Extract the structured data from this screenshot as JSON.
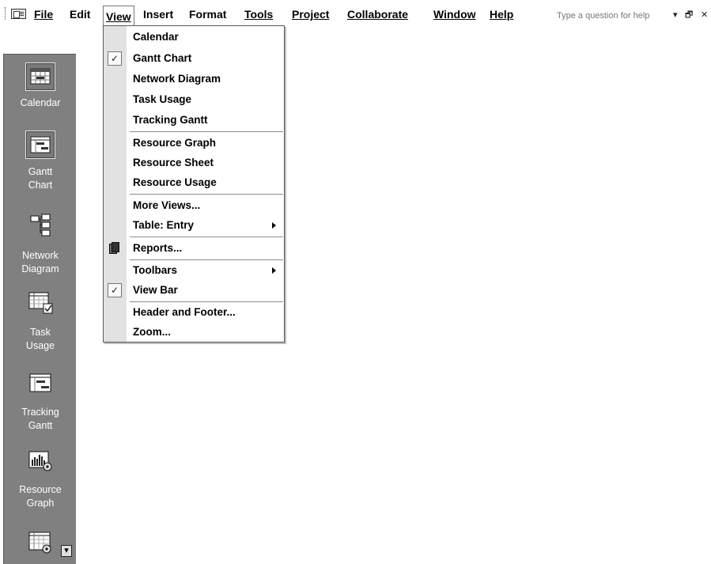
{
  "menubar": {
    "items": [
      {
        "label": "File",
        "active": false
      },
      {
        "label": "Edit",
        "active": false
      },
      {
        "label": "View",
        "active": true
      },
      {
        "label": "Insert",
        "active": false
      },
      {
        "label": "Format",
        "active": false
      },
      {
        "label": "Tools",
        "active": false
      },
      {
        "label": "Project",
        "active": false
      },
      {
        "label": "Collaborate",
        "active": false
      },
      {
        "label": "Window",
        "active": false
      },
      {
        "label": "Help",
        "active": false
      }
    ],
    "help_placeholder": "Type a question for help",
    "controls": {
      "dropdown": "▾",
      "restore": "🗗",
      "close": "✕"
    }
  },
  "view_menu": {
    "items": [
      {
        "label": "Calendar",
        "checked": false
      },
      {
        "label": "Gantt Chart",
        "checked": true
      },
      {
        "label": "Network Diagram",
        "checked": false
      },
      {
        "label": "Task Usage",
        "checked": false
      },
      {
        "label": "Tracking Gantt",
        "checked": false
      },
      {
        "label": "Resource Graph",
        "checked": false
      },
      {
        "label": "Resource Sheet",
        "checked": false
      },
      {
        "label": "Resource Usage",
        "checked": false
      },
      {
        "label": "More Views...",
        "checked": false
      },
      {
        "label": "Table: Entry",
        "submenu": true
      },
      {
        "label": "Reports...",
        "icon": "reports-icon"
      },
      {
        "label": "Toolbars",
        "submenu": true
      },
      {
        "label": "View Bar",
        "checked": true
      },
      {
        "label": "Header and Footer...",
        "checked": false
      },
      {
        "label": "Zoom...",
        "checked": false
      }
    ]
  },
  "view_bar": {
    "buttons": [
      {
        "label": "Calendar",
        "icon": "calendar-view-icon",
        "selected": true
      },
      {
        "label_line1": "Gantt",
        "label_line2": "Chart",
        "icon": "gantt-chart-view-icon",
        "selected": true
      },
      {
        "label_line1": "Network",
        "label_line2": "Diagram",
        "icon": "network-diagram-view-icon"
      },
      {
        "label_line1": "Task",
        "label_line2": "Usage",
        "icon": "task-usage-view-icon"
      },
      {
        "label_line1": "Tracking",
        "label_line2": "Gantt",
        "icon": "tracking-gantt-view-icon"
      },
      {
        "label_line1": "Resource",
        "label_line2": "Graph",
        "icon": "resource-graph-view-icon"
      },
      {
        "icon": "resource-sheet-view-icon"
      }
    ],
    "scroll_down": "▾"
  },
  "colors": {
    "viewbar_bg": "#808080",
    "menu_gutter": "#e2e2e2",
    "menu_border": "#5a5a5a"
  }
}
